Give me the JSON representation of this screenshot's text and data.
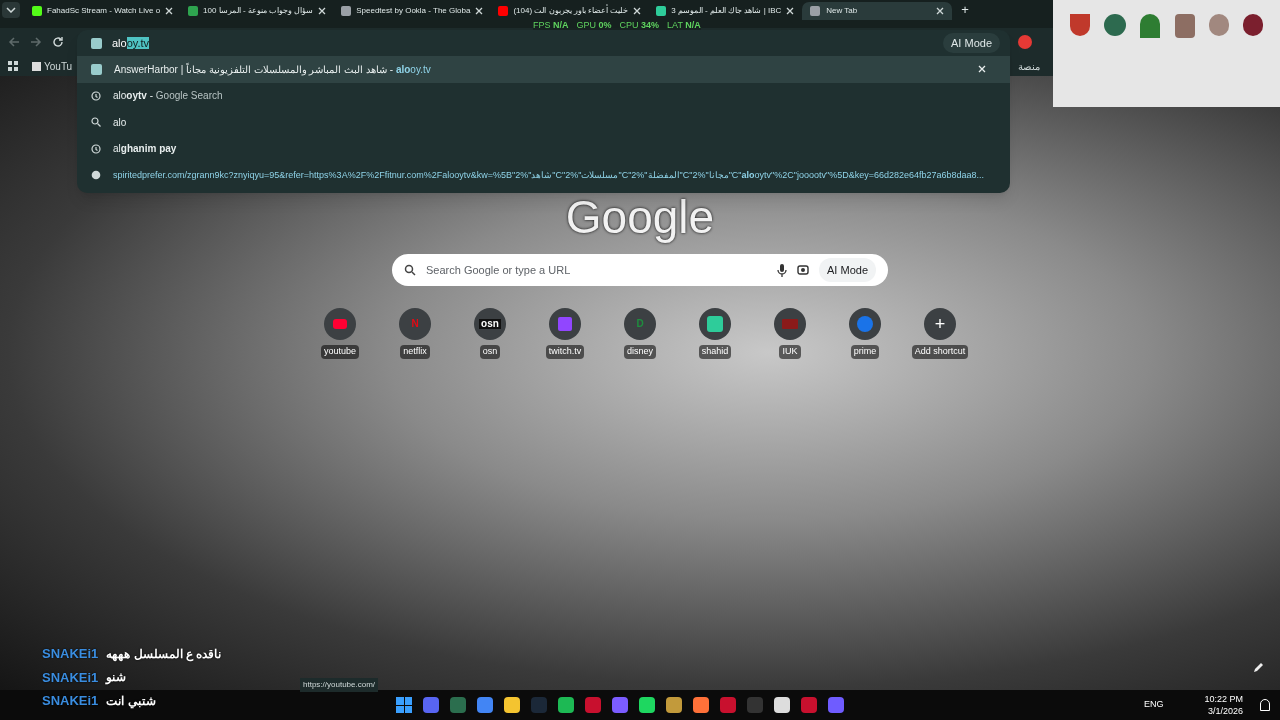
{
  "tabs": [
    {
      "title": "FahadSc Stream - Watch Live o",
      "color": "#53fc18",
      "selected": false
    },
    {
      "title": "100 سؤال وجواب منوعة - المرسا",
      "color": "#2ea44f",
      "selected": false
    },
    {
      "title": "Speedtest by Ookla - The Globa",
      "color": "#9aa0a6",
      "selected": false
    },
    {
      "title": "(104) خليت أعضاء باور يجربون الت",
      "color": "#ff0000",
      "selected": false
    },
    {
      "title": "شاهد جاك العلم - الموسم 3 | IBC",
      "color": "#2ecc9a",
      "selected": false
    },
    {
      "title": "New Tab",
      "color": "#9aa0a6",
      "selected": true
    }
  ],
  "new_tab_button": "+",
  "perf_overlay": [
    {
      "label": "FPS",
      "value": "N/A"
    },
    {
      "label": "GPU",
      "value": "0%"
    },
    {
      "label": "CPU",
      "value": "34%"
    },
    {
      "label": "LAT",
      "value": "N/A"
    }
  ],
  "omnibox": {
    "typed": "alo",
    "completion": "oy.tv"
  },
  "ai_mode_button": "AI Mode",
  "bookmarks": [
    {
      "label": "YouTu"
    }
  ],
  "bookmarks_right": "منصة",
  "suggestions": [
    {
      "kind": "site",
      "text": "AnswerHarbor | شاهد البث المباشر والمسلسلات التلفزيونية مجاناً",
      "separator": "-",
      "url": "**alo**oy.tv",
      "selected": true
    },
    {
      "kind": "history",
      "text": "alo**oytv**",
      "separator": "-",
      "suffix": "Google Search",
      "selected": false
    },
    {
      "kind": "search",
      "text": "alo",
      "selected": false
    },
    {
      "kind": "history",
      "text": "al**ghanim pay**",
      "selected": false
    },
    {
      "kind": "url",
      "url": "spiritedprefer.com/zgrann9kc?znyiqyu=95&refer=https%3A%2F%2Ffitnur.com%2Falooytv&kw=%5B\"2%\"شاهد\"C\"2%\"مسلسلات\"C\"2%\"المفضلة\"C\"2%\"مجانا\"C\"**alo**oytv\"%2C\"jooootv\"%5D&key=66d282e64fb27a6b8daa8...",
      "selected": false
    }
  ],
  "logo": "Google",
  "search": {
    "placeholder": "Search Google or type a URL",
    "ai_mode": "AI Mode"
  },
  "shortcuts": [
    {
      "kind": "youtube",
      "label": "youtube",
      "color": "#ff0033"
    },
    {
      "kind": "letter",
      "label": "netflix",
      "glyph": "N",
      "color": "#e50914"
    },
    {
      "kind": "letter",
      "label": "osn",
      "glyph": "osn",
      "color": "#111111"
    },
    {
      "kind": "twitch",
      "label": "twitch.tv",
      "color": "#9146ff"
    },
    {
      "kind": "letter",
      "label": "disney",
      "glyph": "D",
      "color": "#1e8e3e"
    },
    {
      "kind": "grid",
      "label": "shahid",
      "color": "#2ecc9a"
    },
    {
      "kind": "tile",
      "label": "IUK",
      "color": "#8b1a1a"
    },
    {
      "kind": "play",
      "label": "prime",
      "color": "#1a73e8"
    },
    {
      "kind": "add",
      "label": "Add shortcut",
      "glyph": "+"
    }
  ],
  "chat": [
    {
      "user": "SNAKEi1",
      "message": "ناقده ع المسلسل هههه"
    },
    {
      "user": "SNAKEi1",
      "message": "شنو"
    },
    {
      "user": "SNAKEi1",
      "message": "شتبي انت"
    }
  ],
  "status_url": "https://youtube.com/",
  "taskbar": {
    "apps": [
      {
        "color": "#5865f2"
      },
      {
        "color": "#2b6e4e"
      },
      {
        "color": "#4285f4"
      },
      {
        "color": "#f4c430"
      },
      {
        "color": "#1b2838"
      },
      {
        "color": "#1db954"
      },
      {
        "color": "#c8102e"
      },
      {
        "color": "#7b5cff"
      },
      {
        "color": "#1ed760"
      },
      {
        "color": "#c29a3b"
      },
      {
        "color": "#ff7139"
      },
      {
        "color": "#c8102e"
      },
      {
        "color": "#333333"
      },
      {
        "color": "#dddddd"
      },
      {
        "color": "#c8102e"
      },
      {
        "color": "#6f5cff"
      }
    ],
    "language": "ENG",
    "time": "10:22 PM",
    "date": "3/1/2026"
  }
}
